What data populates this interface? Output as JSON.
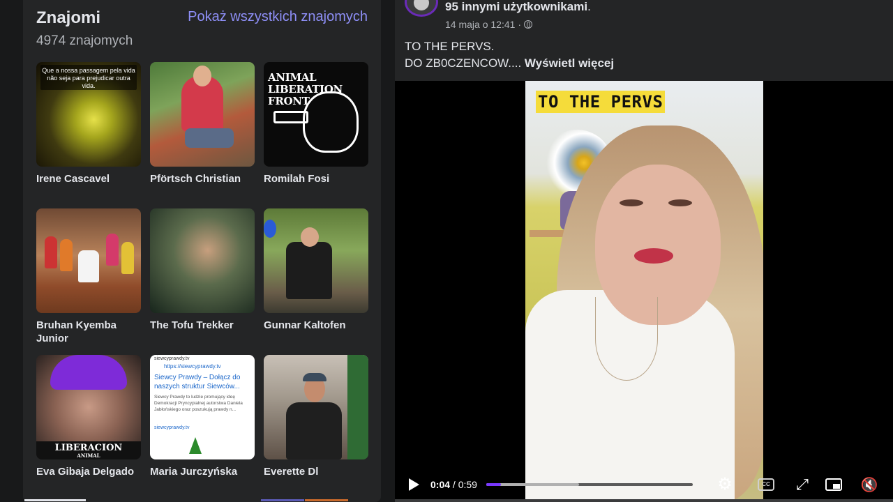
{
  "friends": {
    "title": "Znajomi",
    "count": "4974 znajomych",
    "show_all": "Pokaż wszystkich znajomych",
    "items": [
      {
        "name": "Irene Cascavel",
        "photo_caption": "Que a nossa passagem pela vida não seja para prejudicar outra vida."
      },
      {
        "name": "Pförtsch Christian"
      },
      {
        "name": "Romilah Fosi",
        "photo_text": "ANIMAL LIBERATION FRONT"
      },
      {
        "name": "Bruhan Kyemba Junior"
      },
      {
        "name": "The Tofu Trekker"
      },
      {
        "name": "Gunnar Kaltofen"
      },
      {
        "name": "Eva Gibaja Delgado",
        "photo_banner": "LIBERACION",
        "photo_banner_sub": "ANIMAL"
      },
      {
        "name": "Maria Jurczyńska",
        "photo_site": "siewcyprawdy.tv",
        "photo_url": "https://siewcyprawdy.tv",
        "photo_headline": "Siewcy Prawdy – Dołącz do naszych struktur Siewców...",
        "photo_body": "Siewcy Prawdy to ludzie promujący ideę Demokracji Pryncypialnej autorstwa Daniela Jabłońskiego oraz poszukują prawdy n...",
        "photo_foot": "siewcyprawdy.tv"
      },
      {
        "name": "Everette Dl"
      }
    ]
  },
  "post": {
    "with_users": "95 innymi użytkownikami",
    "with_users_suffix": ".",
    "timestamp": "14 maja o 12:41",
    "separator": "·",
    "line1": "TO THE PERVS.",
    "line2": "DO ZB0CZENCOW....",
    "see_more": "Wyświetl więcej"
  },
  "video": {
    "caption": "TO THE PERVS",
    "time_current": "0:04",
    "time_separator": "/",
    "time_total": "0:59",
    "progress_fraction": 0.07,
    "buffered_fraction": 0.45,
    "cc_label": "CC"
  },
  "colors": {
    "accent": "#7a38ff",
    "link": "#8e8ff7",
    "panel": "#242526",
    "background": "#18191a"
  },
  "icons": [
    "play-icon",
    "settings-icon",
    "captions-icon",
    "fullscreen-icon",
    "pip-icon",
    "mute-icon",
    "globe-icon"
  ]
}
